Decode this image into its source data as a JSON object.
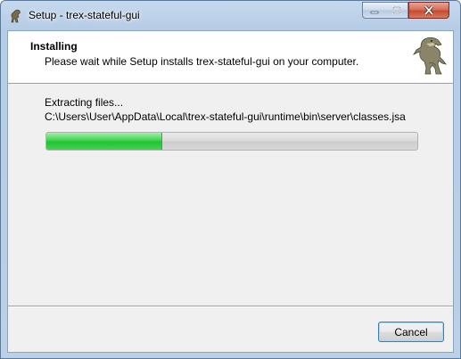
{
  "window": {
    "title": "Setup - trex-stateful-gui",
    "app_icon": "trex-icon",
    "controls": {
      "minimize_icon": "minimize-icon",
      "maximize_icon": "maximize-icon",
      "close_icon": "close-icon"
    }
  },
  "header": {
    "title": "Installing",
    "subtitle": "Please wait while Setup installs trex-stateful-gui on your computer.",
    "image": "dinosaur-icon"
  },
  "main": {
    "status": "Extracting files...",
    "filename": "C:\\Users\\User\\AppData\\Local\\trex-stateful-gui\\runtime\\bin\\server\\classes.jsa",
    "progress_fraction": 0.31
  },
  "footer": {
    "cancel_label": "Cancel"
  },
  "colors": {
    "progress_fill": "#22c232",
    "titlebar": "#c6d9ee",
    "close_button": "#c44b2f"
  }
}
